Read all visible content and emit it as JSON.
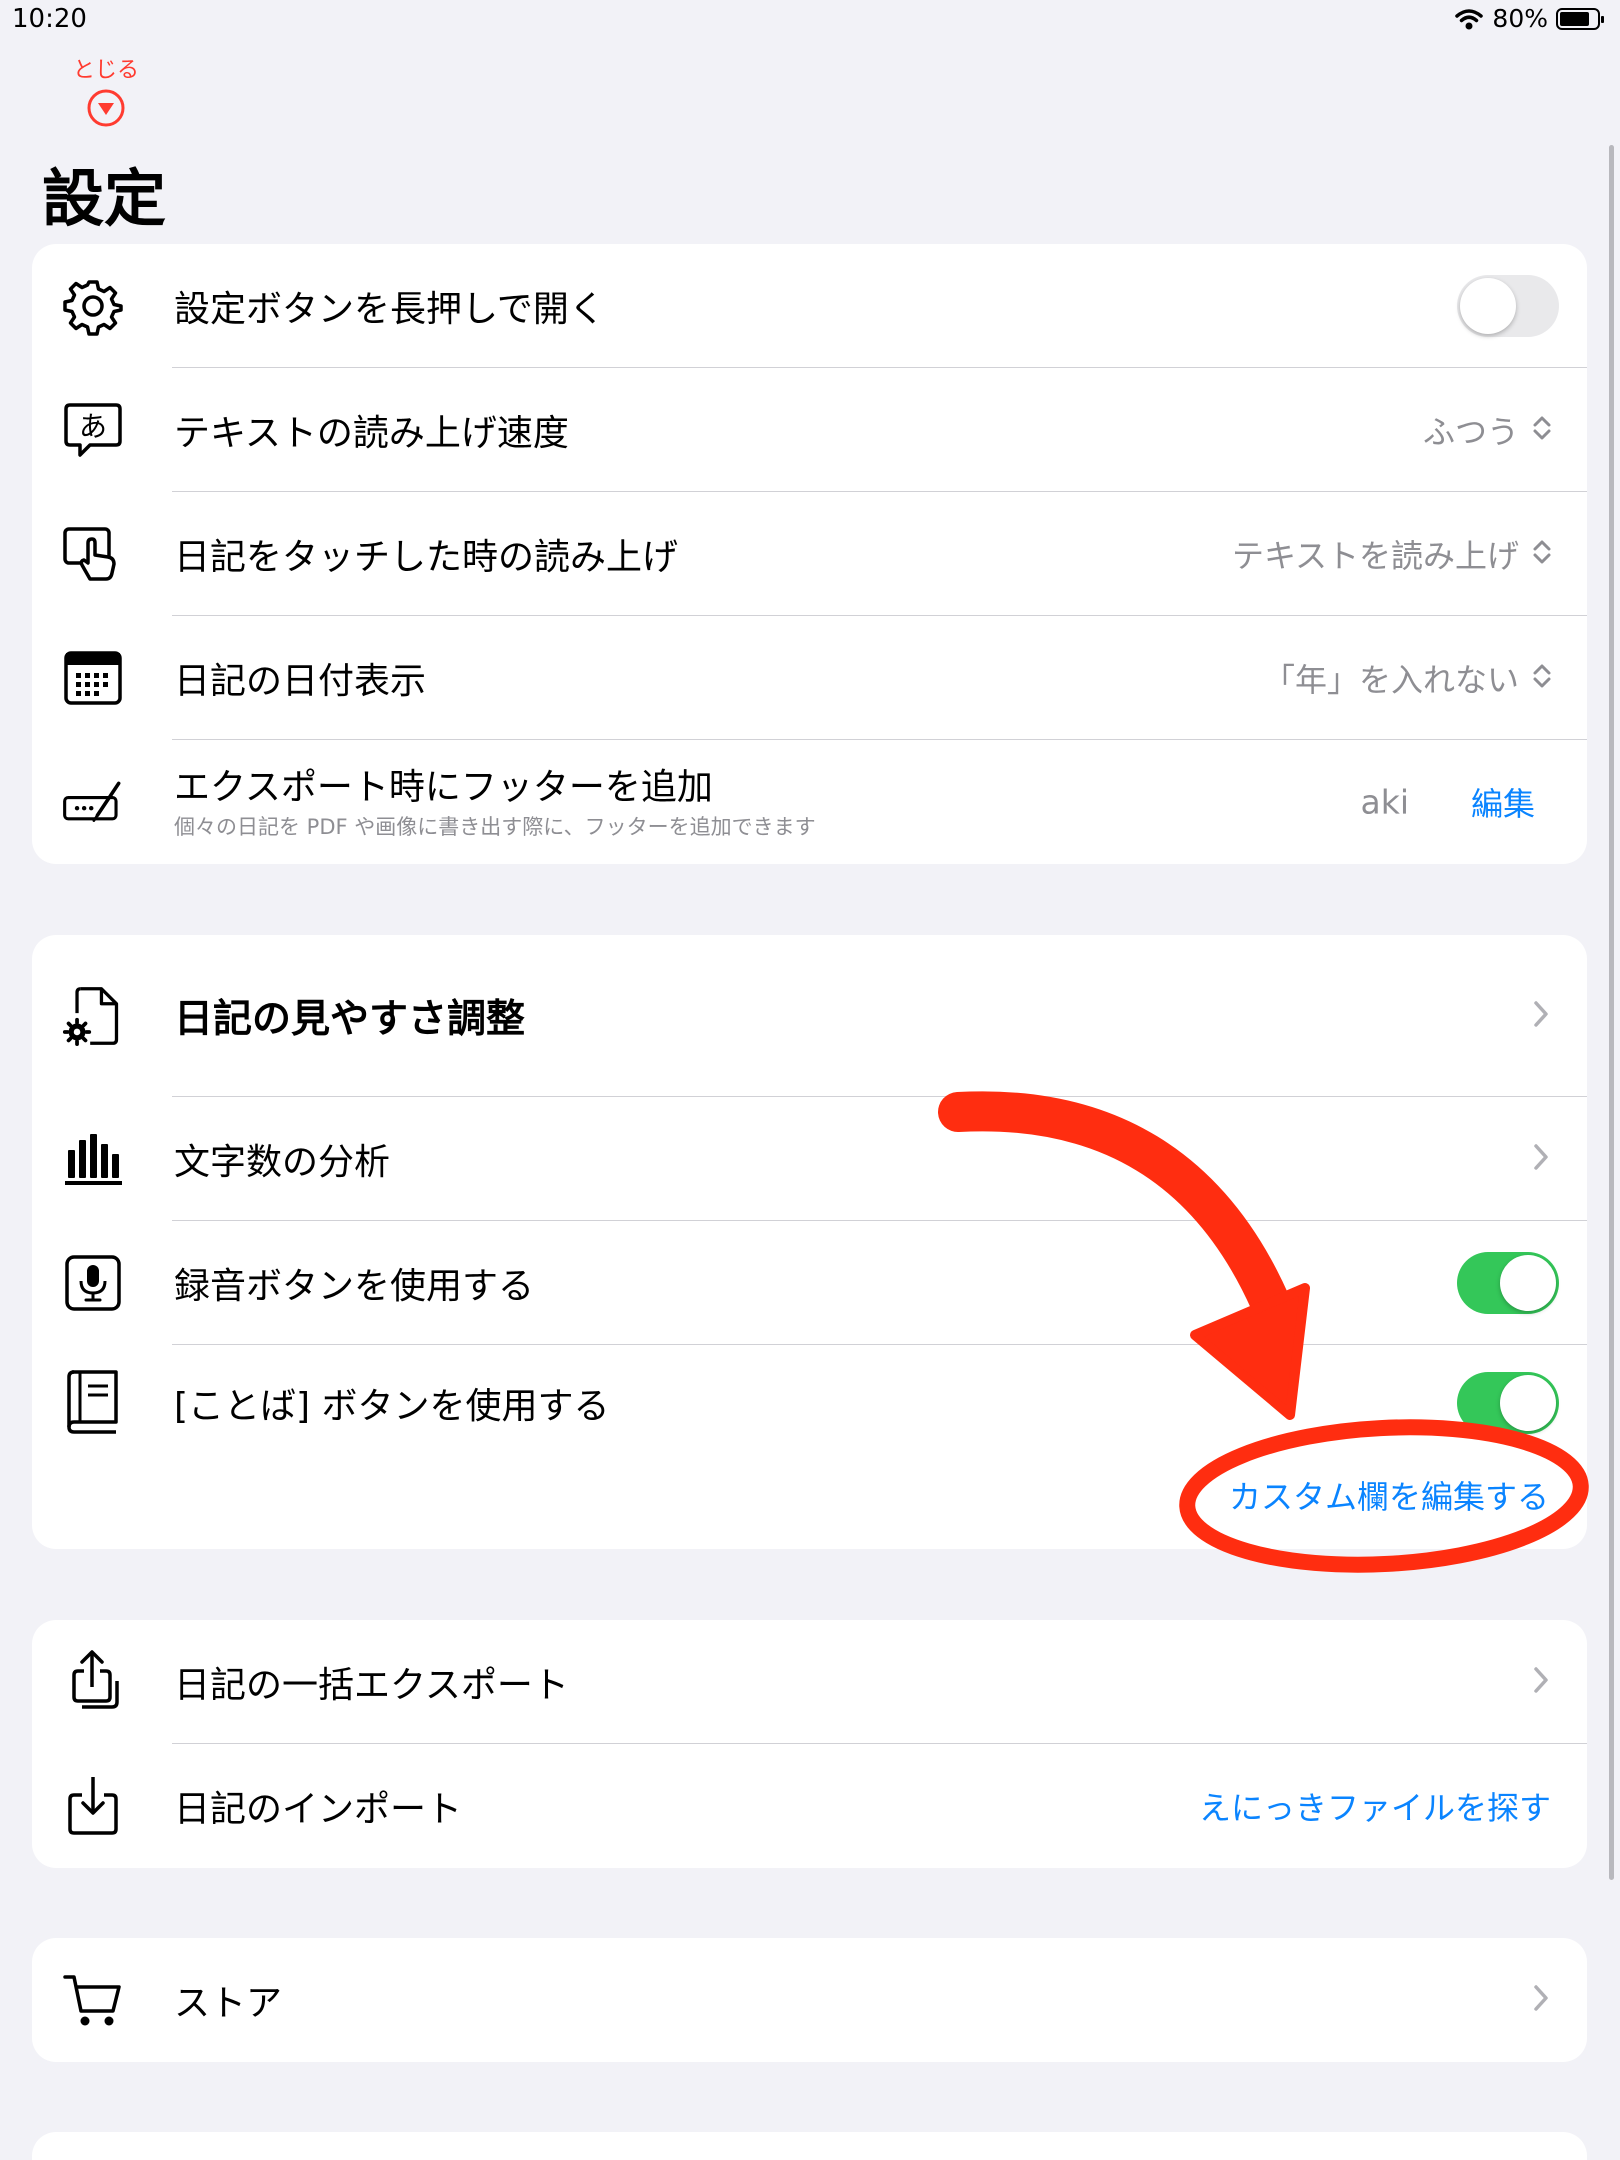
{
  "status": {
    "time": "10:20",
    "battery": "80%"
  },
  "header": {
    "close_label": "とじる",
    "title": "設定"
  },
  "group1": {
    "long_press": {
      "label": "設定ボタンを長押しで開く",
      "toggle_on": false
    },
    "read_speed": {
      "label": "テキストの読み上げ速度",
      "value": "ふつう"
    },
    "touch_read": {
      "label": "日記をタッチした時の読み上げ",
      "value": "テキストを読み上げ"
    },
    "date_display": {
      "label": "日記の日付表示",
      "value": "「年」を入れない"
    },
    "footer": {
      "label": "エクスポート時にフッターを追加",
      "sub": "個々の日記を PDF や画像に書き出す際に、フッターを追加できます",
      "value": "aki",
      "edit": "編集"
    }
  },
  "group2": {
    "visibility": {
      "label": "日記の見やすさ調整"
    },
    "char_count": {
      "label": "文字数の分析"
    },
    "record": {
      "label": "録音ボタンを使用する",
      "toggle_on": true
    },
    "kotoba": {
      "label": "[ことば] ボタンを使用する",
      "toggle_on": true,
      "custom_link": "カスタム欄を編集する"
    }
  },
  "group3": {
    "bulk_export": {
      "label": "日記の一括エクスポート"
    },
    "import": {
      "label": "日記のインポート",
      "link": "えにっきファイルを探す"
    }
  },
  "group4": {
    "store": {
      "label": "ストア"
    }
  },
  "icons": [
    "wifi-icon",
    "battery-icon",
    "close-circle-icon",
    "gear-icon",
    "speech-bubble-icon",
    "touch-hand-icon",
    "calendar-icon",
    "signature-icon",
    "doc-gear-icon",
    "bar-chart-icon",
    "microphone-icon",
    "book-icon",
    "share-icon",
    "download-icon",
    "cart-icon",
    "chevron-right-icon",
    "up-down-chevron-icon"
  ],
  "colors": {
    "accent": "#0a84ff",
    "toggle_on": "#34c759",
    "annotation": "#ff2d10",
    "close": "#ff3b30"
  }
}
